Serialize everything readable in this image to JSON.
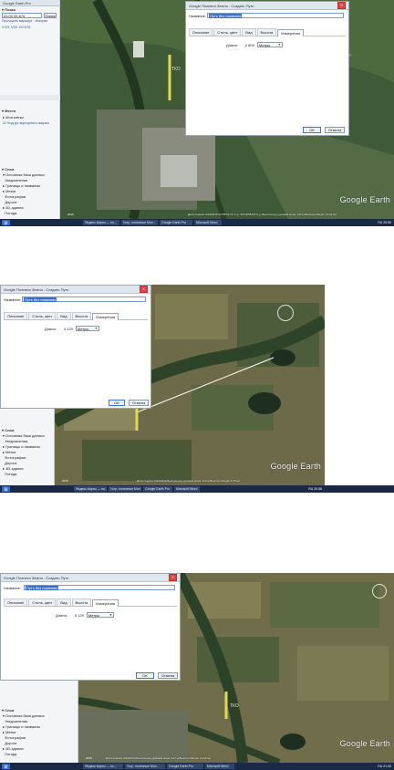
{
  "dialog": {
    "title": "Google Планета Земля - Создать Путь",
    "name_label": "Название:",
    "name_value": "Путь без названия",
    "tabs": [
      "Описание",
      "Стиль, цвет",
      "Вид",
      "Высота",
      "Измерения"
    ],
    "active_tab": "Измерения",
    "length_label": "Длина:",
    "units_value": "Метры",
    "ok_label": "ОК",
    "cancel_label": "Отмена"
  },
  "screens": [
    {
      "length_value": "2 809",
      "map_label": "ТКО",
      "status": "Дата съемки: 6/19/2019  54°35'13.71\" с.ш. 55°29'58.00\" в.д.  Высота над уровнем моря: 122 м  Высота обзора: 13.31 км",
      "year": "2015"
    },
    {
      "length_value": "4 129",
      "map_label": "",
      "status": "Дата съемки: 6/19/2019  Высота над уровнем моря: 113 м  Высота обзора: 6.75 км",
      "year": "2015"
    },
    {
      "length_value": "5 129",
      "map_label": "ТКО",
      "status": "Дата съемки: 6/19/2019  Высота над уровнем моря: 127 м  Высота обзора: 12.93 км",
      "year": "2015"
    }
  ],
  "app": {
    "window_title": "Google Earth Pro",
    "search_header": "Поиск",
    "search_value": "53.00 55.676",
    "search_button": "Поиск",
    "route_link": "Проложить маршрут",
    "history_link": "История",
    "result_item": "53, V02 :00:676",
    "places_header": "Места",
    "my_places": "Мои метки",
    "temp_place": "Ход до мусорного ящика",
    "layers_header": "Слои",
    "layers": [
      "Основная база данных",
      "Уведомления",
      "Границы и названия",
      "Метки",
      "Фотографии",
      "Дороги",
      "3D-здания",
      "Погода"
    ]
  },
  "branding": {
    "logo": "Google Earth"
  },
  "taskbar": {
    "items": [
      "Яндекс.Карты — по...",
      "Устр. полезные Мон...",
      "Google Earth Pro",
      "Microsoft Word"
    ],
    "clock_1": "20:50",
    "clock_2": "20:56",
    "clock_3": "21:00",
    "lang": "RU"
  },
  "colors": {
    "map_green": "#3f5a36",
    "map_dark": "#2a3d2a",
    "field_tan": "#8d8a5e",
    "selection": "#3a70c8",
    "taskbar": "#1a2a44"
  }
}
